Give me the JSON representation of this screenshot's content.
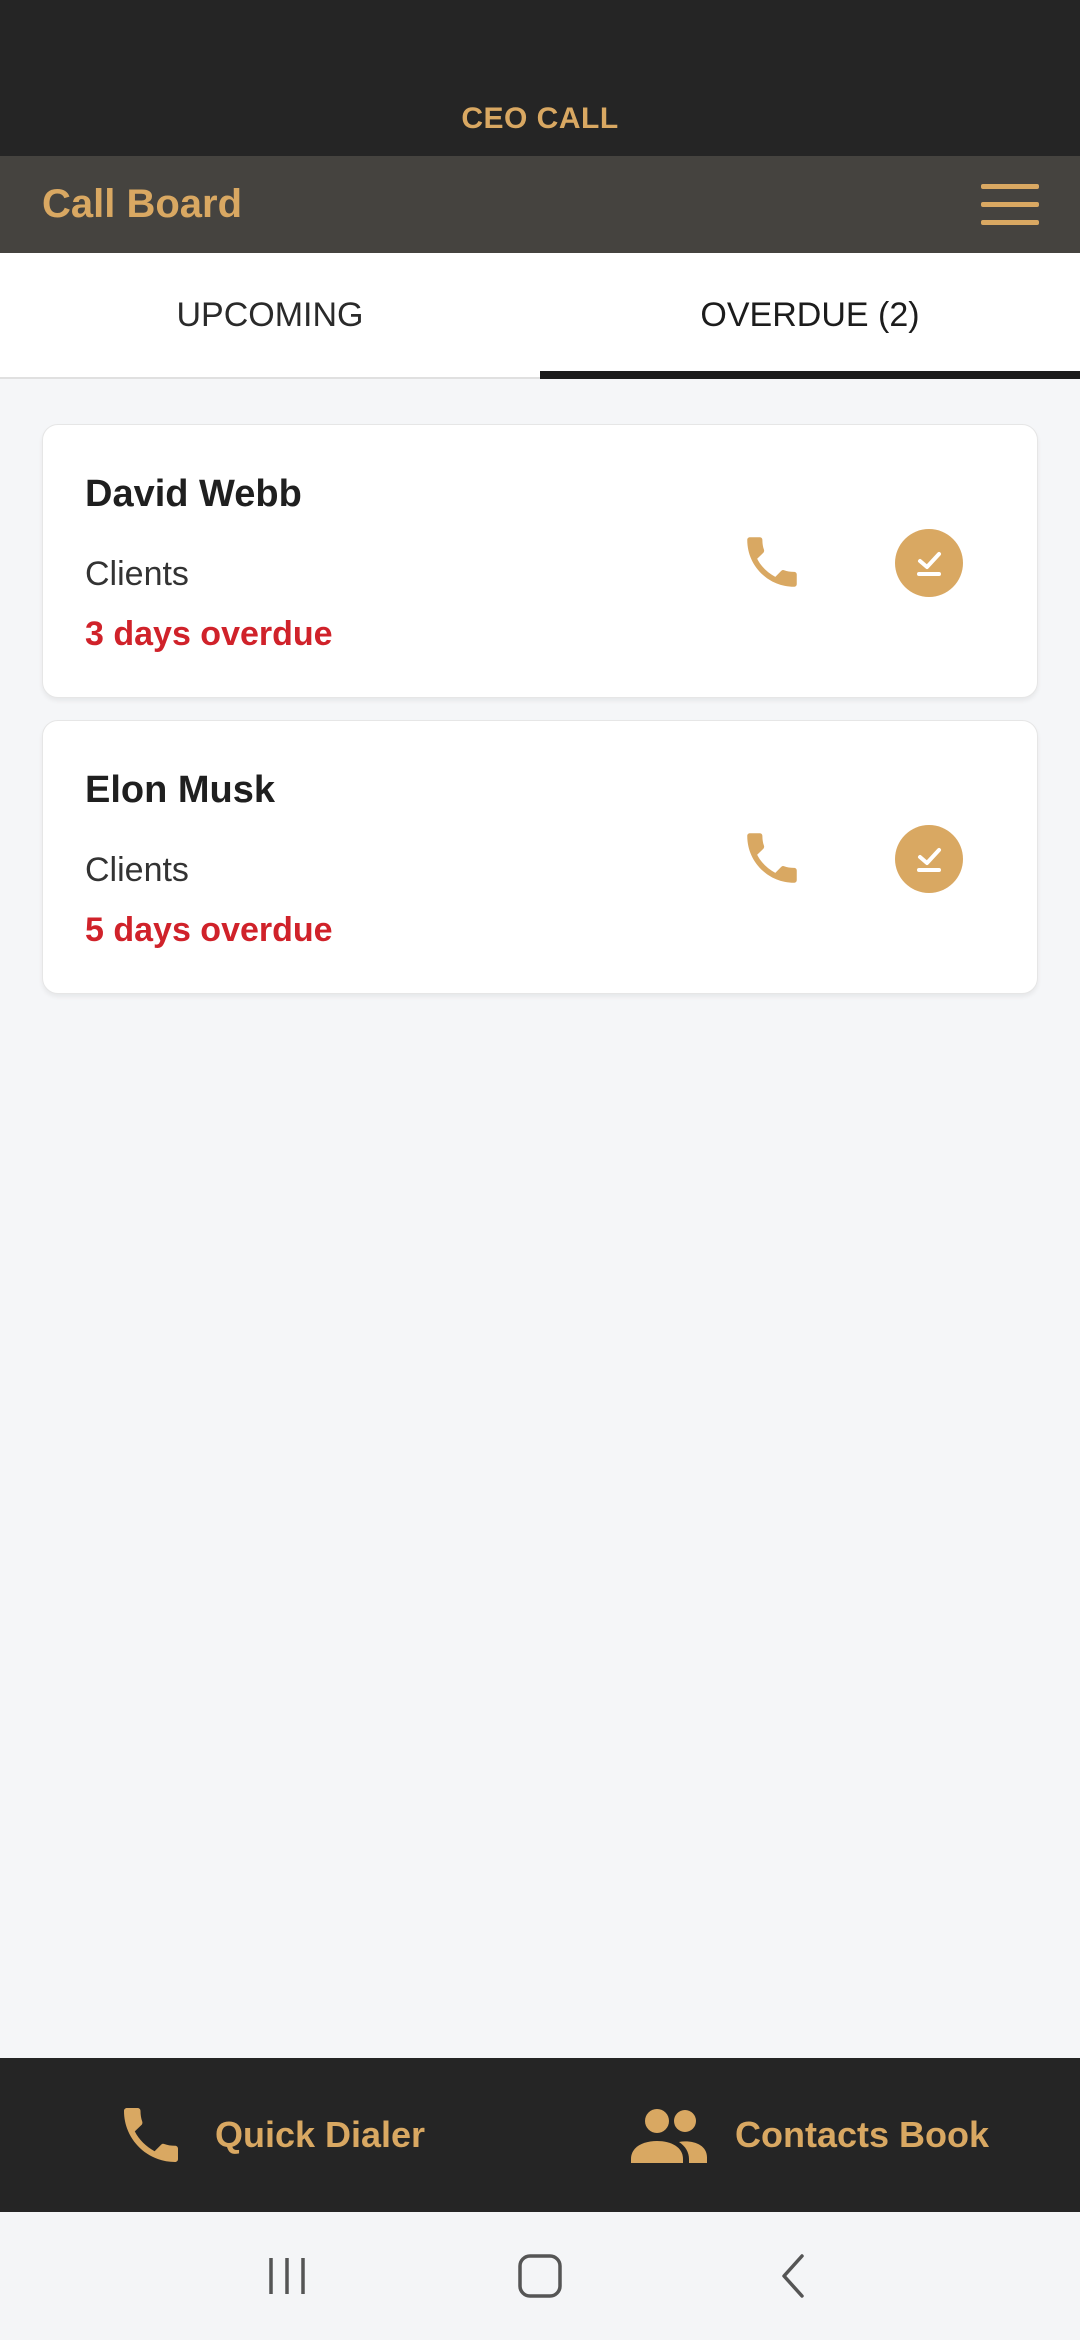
{
  "status_bar": {
    "brand": "CEO CALL"
  },
  "app_bar": {
    "title": "Call Board",
    "menu_icon": "hamburger-menu-icon"
  },
  "tabs": [
    {
      "label": "UPCOMING",
      "active": false
    },
    {
      "label": "OVERDUE (2)",
      "active": true
    }
  ],
  "calls": [
    {
      "name": "David Webb",
      "group": "Clients",
      "status": "3 days overdue"
    },
    {
      "name": "Elon Musk",
      "group": "Clients",
      "status": "5 days overdue"
    }
  ],
  "bottom_nav": [
    {
      "label": "Quick Dialer",
      "icon": "phone-icon"
    },
    {
      "label": "Contacts Book",
      "icon": "people-icon"
    }
  ],
  "colors": {
    "accent": "#d9a862",
    "dark_bar": "#252525",
    "app_bar": "#45433f",
    "overdue": "#d0222a",
    "background": "#f5f6f8"
  }
}
